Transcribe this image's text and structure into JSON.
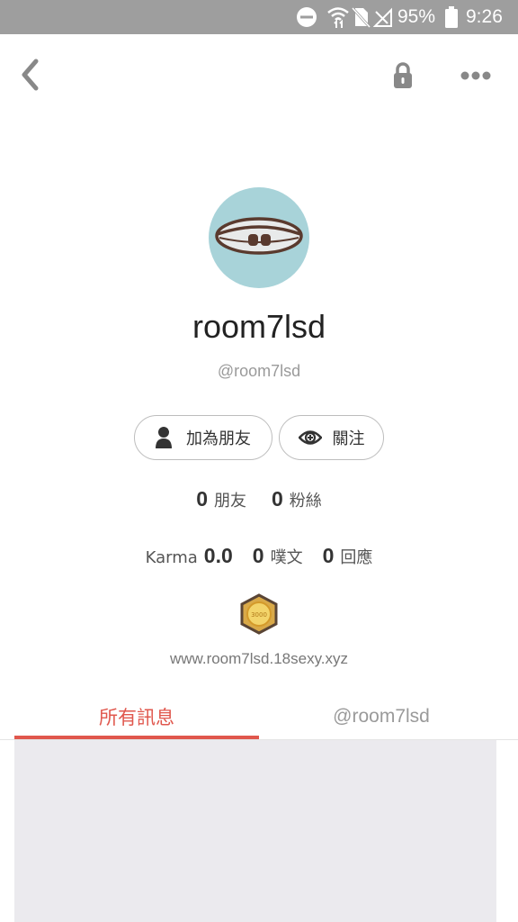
{
  "status_bar": {
    "battery_percent": "95%",
    "time": "9:26",
    "icons": [
      "do-not-disturb-icon",
      "wifi-icon",
      "no-sim-icon",
      "no-signal-icon",
      "battery-icon"
    ]
  },
  "top_bar": {
    "icons": [
      "back-icon",
      "lock-icon",
      "more-icon"
    ]
  },
  "profile": {
    "display_name": "room7lsd",
    "handle": "@room7lsd",
    "avatar_color": "#a8d3d9"
  },
  "actions": {
    "add_friend_label": "加為朋友",
    "follow_label": "關注"
  },
  "stats": {
    "friends_count": "0",
    "friends_label": "朋友",
    "fans_count": "0",
    "fans_label": "粉絲",
    "karma_label": "Karma",
    "karma_value": "0.0",
    "posts_count": "0",
    "posts_label": "噗文",
    "replies_count": "0",
    "replies_label": "回應"
  },
  "badge": {
    "text": "3000",
    "icon": "badge-hexagon-icon"
  },
  "website": "www.room7lsd.18sexy.xyz",
  "tabs": [
    {
      "label": "所有訊息",
      "active": true
    },
    {
      "label": "@room7lsd",
      "active": false
    }
  ],
  "colors": {
    "accent": "#e0574d",
    "status_bar": "#9e9e9e",
    "content_bg": "#ebeaee"
  }
}
